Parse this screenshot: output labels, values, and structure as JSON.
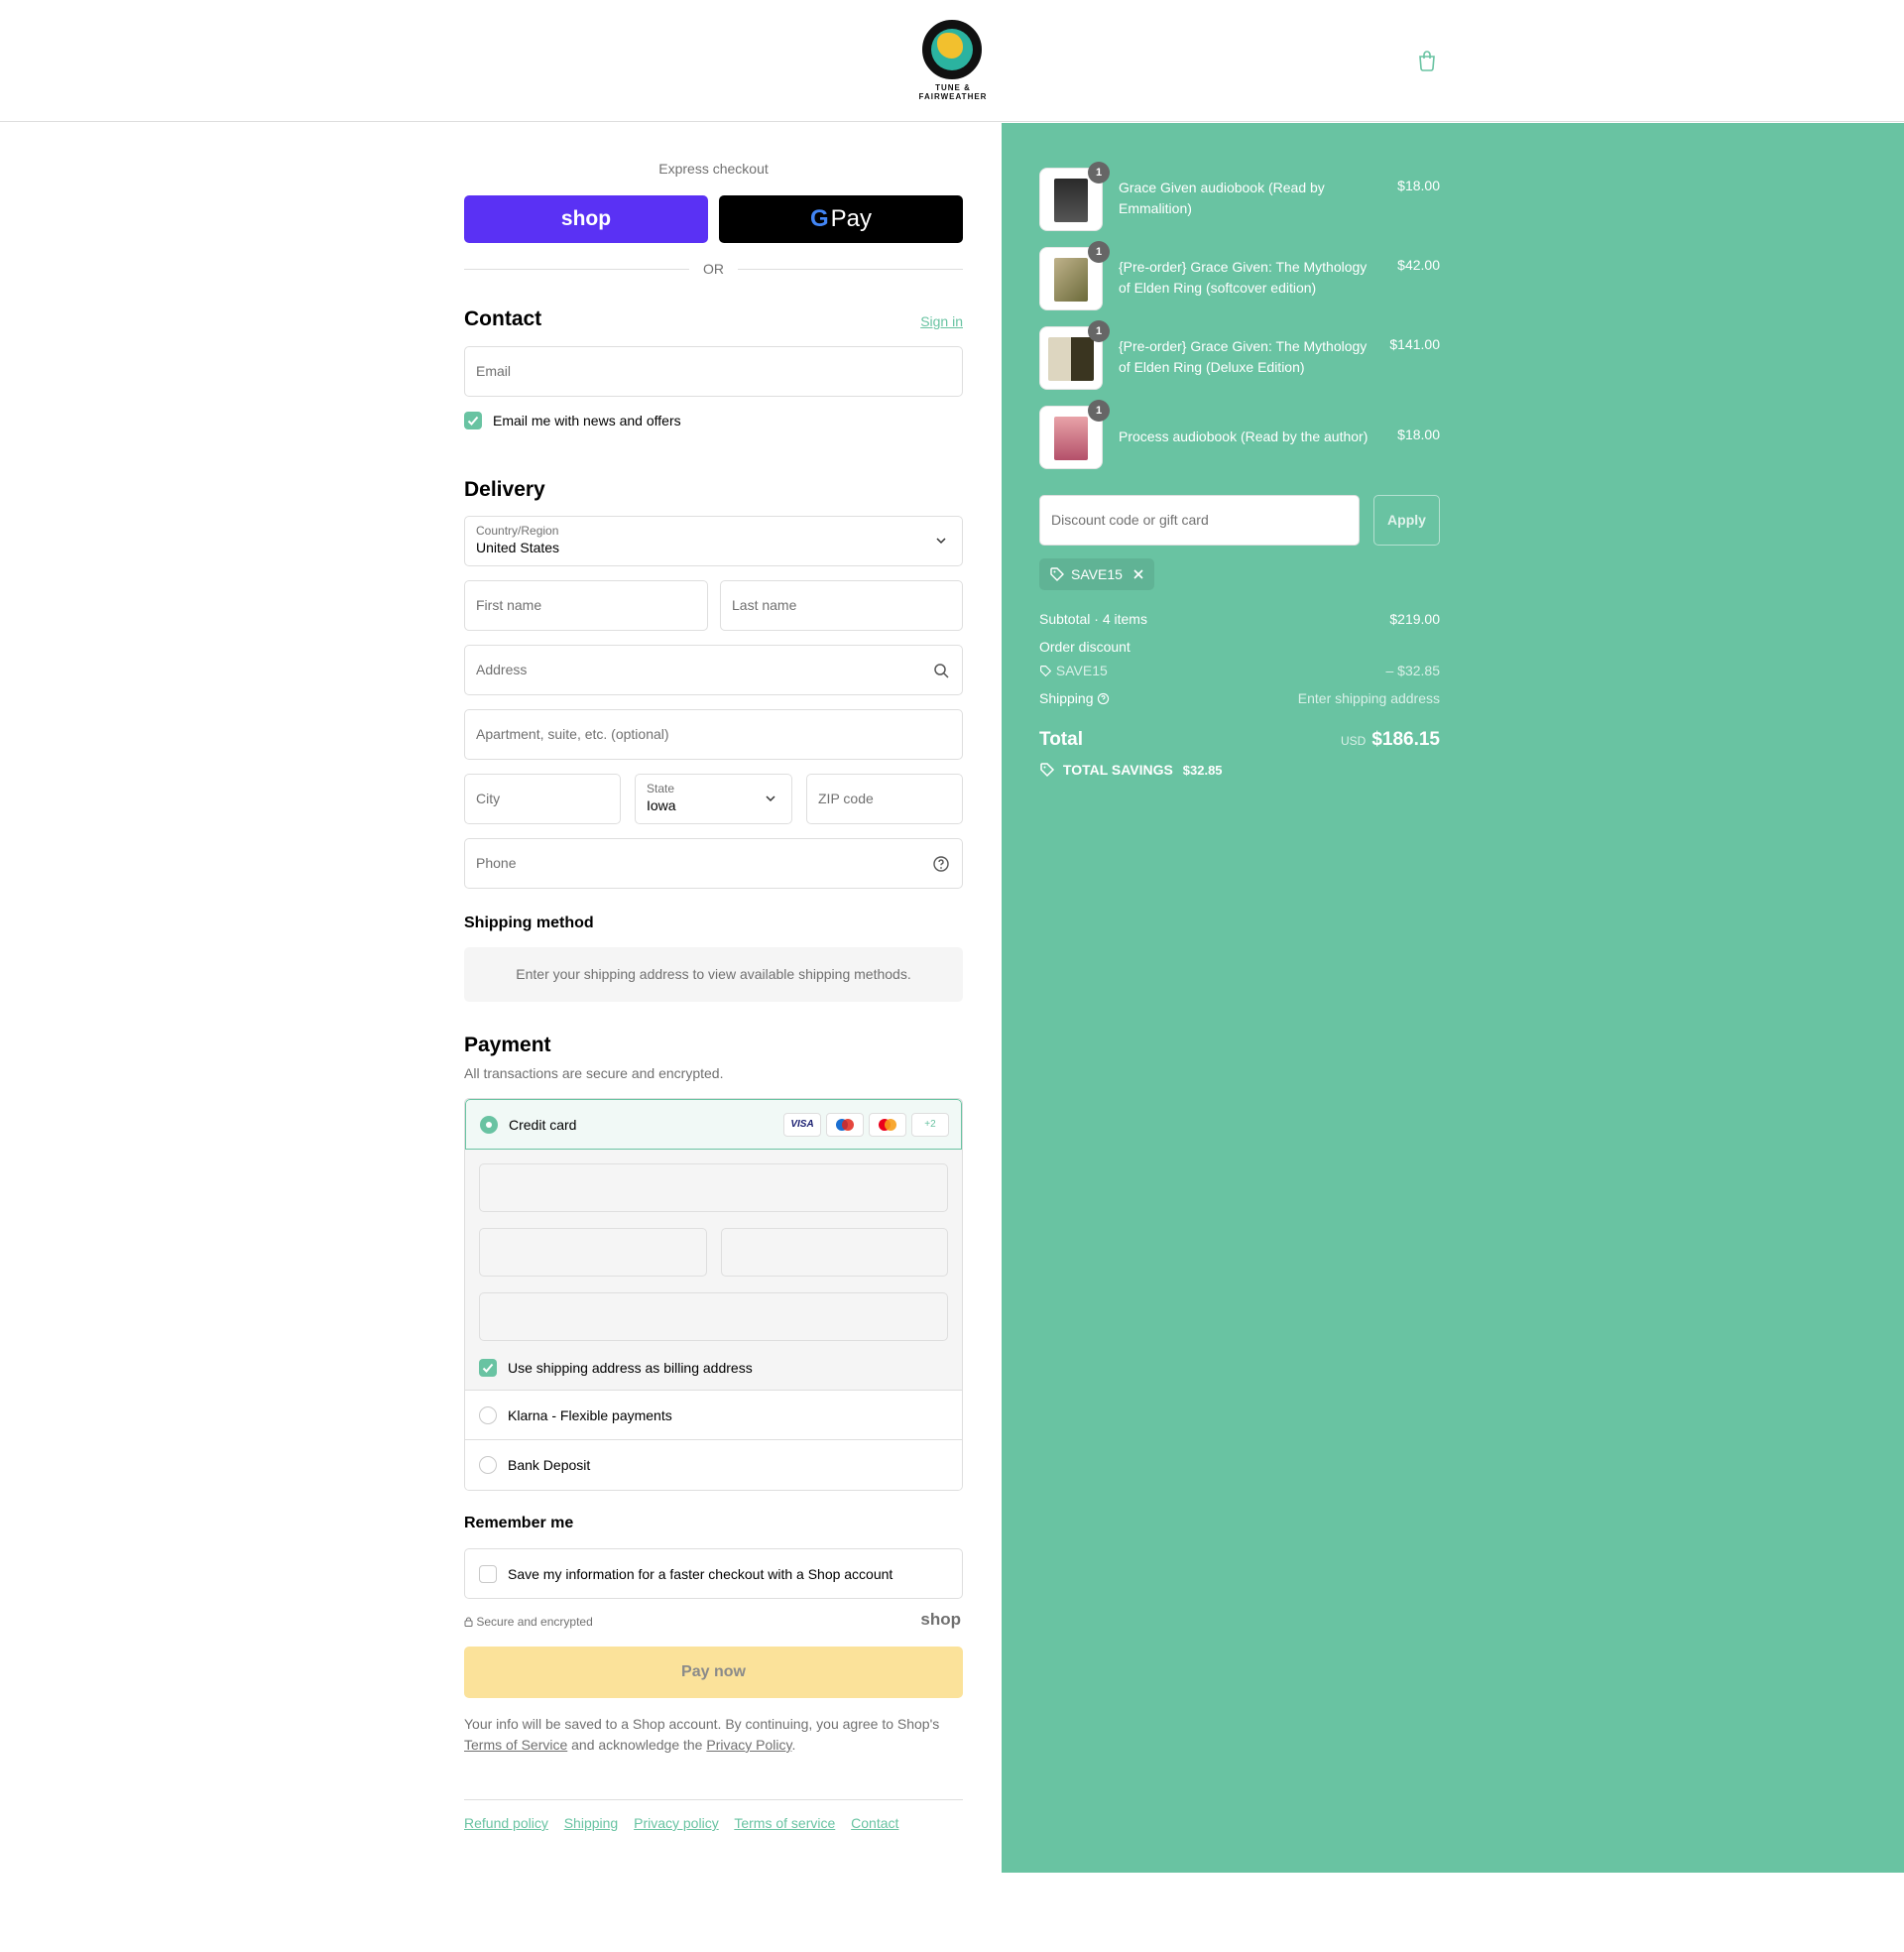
{
  "header": {
    "logo_line1": "TUNE &",
    "logo_line2": "FAIRWEATHER",
    "cart_icon": "shopping-bag-icon"
  },
  "express": {
    "title": "Express checkout",
    "shop_label": "shop",
    "gpay_g": "G",
    "gpay_label": "Pay",
    "or_label": "OR"
  },
  "contact": {
    "title": "Contact",
    "sign_in": "Sign in",
    "email_placeholder": "Email",
    "newsletter_label": "Email me with news and offers",
    "newsletter_checked": true
  },
  "delivery": {
    "title": "Delivery",
    "country_label": "Country/Region",
    "country_value": "United States",
    "first_name_placeholder": "First name",
    "last_name_placeholder": "Last name",
    "address_placeholder": "Address",
    "apartment_placeholder": "Apartment, suite, etc. (optional)",
    "city_placeholder": "City",
    "state_label": "State",
    "state_value": "Iowa",
    "zip_placeholder": "ZIP code",
    "phone_placeholder": "Phone"
  },
  "shipping_method": {
    "title": "Shipping method",
    "message": "Enter your shipping address to view available shipping methods."
  },
  "payment": {
    "title": "Payment",
    "subtitle": "All transactions are secure and encrypted.",
    "credit_card_label": "Credit card",
    "card_badges": [
      "VISA",
      "",
      "",
      "+2"
    ],
    "billing_same_label": "Use shipping address as billing address",
    "klarna_label": "Klarna - Flexible payments",
    "bank_label": "Bank Deposit"
  },
  "remember": {
    "title": "Remember me",
    "save_label": "Save my information for a faster checkout with a Shop account",
    "secure_label": "Secure and encrypted",
    "shop_mark": "shop"
  },
  "pay_now_label": "Pay now",
  "legal": {
    "text1": "Your info will be saved to a Shop account. By continuing, you agree to Shop's ",
    "terms": "Terms of Service",
    "text2": " and acknowledge the ",
    "privacy": "Privacy Policy",
    "text3": "."
  },
  "footer_links": [
    "Refund policy",
    "Shipping",
    "Privacy policy",
    "Terms of service",
    "Contact"
  ],
  "summary": {
    "items": [
      {
        "name": "Grace Given audiobook (Read by Emmalition)",
        "price": "$18.00",
        "qty": "1"
      },
      {
        "name": "{Pre-order} Grace Given: The Mythology of Elden Ring (softcover edition)",
        "price": "$42.00",
        "qty": "1"
      },
      {
        "name": "{Pre-order} Grace Given: The Mythology of Elden Ring (Deluxe Edition)",
        "price": "$141.00",
        "qty": "1"
      },
      {
        "name": "Process audiobook (Read by the author)",
        "price": "$18.00",
        "qty": "1"
      }
    ],
    "discount_placeholder": "Discount code or gift card",
    "apply_label": "Apply",
    "applied_code": "SAVE15",
    "subtotal_label": "Subtotal · 4 items",
    "subtotal_value": "$219.00",
    "order_discount_label": "Order discount",
    "discount_code": "SAVE15",
    "discount_value": "– $32.85",
    "shipping_label": "Shipping",
    "shipping_value": "Enter shipping address",
    "total_label": "Total",
    "currency": "USD",
    "total_value": "$186.15",
    "savings_label": "TOTAL SAVINGS",
    "savings_value": "$32.85"
  },
  "colors": {
    "accent": "#69c3a2",
    "shop_purple": "#5a31f4",
    "pay_button": "#fbe29a"
  }
}
